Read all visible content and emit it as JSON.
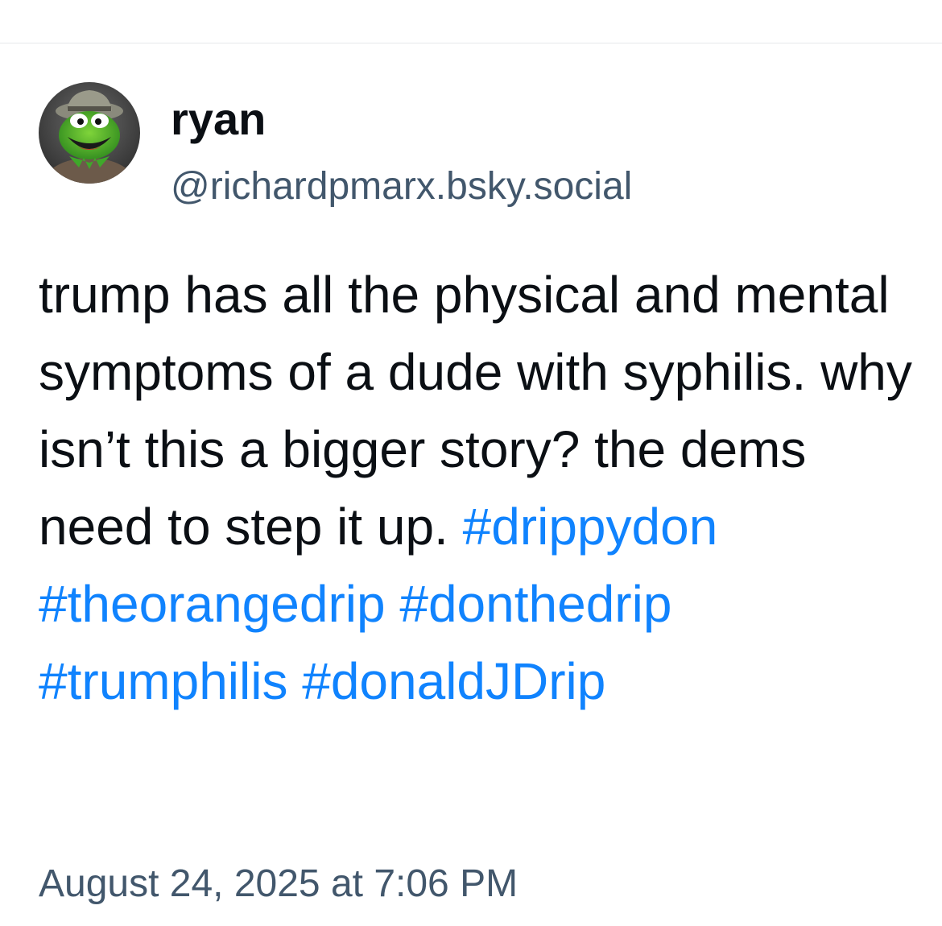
{
  "post": {
    "author": {
      "display_name": "ryan",
      "handle": "@richardpmarx.bsky.social",
      "avatar_icon": "kermit-avatar-icon"
    },
    "text_segments": [
      "trump has all the physical and mental symptoms of a dude with syphilis. why isn’t this a bigger story?  the dems need to step it up. "
    ],
    "hashtags": [
      "#drippydon",
      "#theorangedrip",
      "#donthedrip",
      "#trumphilis",
      "#donaldJDrip"
    ],
    "timestamp": "August 24, 2025 at 7:06 PM"
  },
  "colors": {
    "hashtag": "#1083fe",
    "secondary_text": "#42576c",
    "primary_text": "#0b0f14",
    "divider": "#e6e8eb"
  }
}
